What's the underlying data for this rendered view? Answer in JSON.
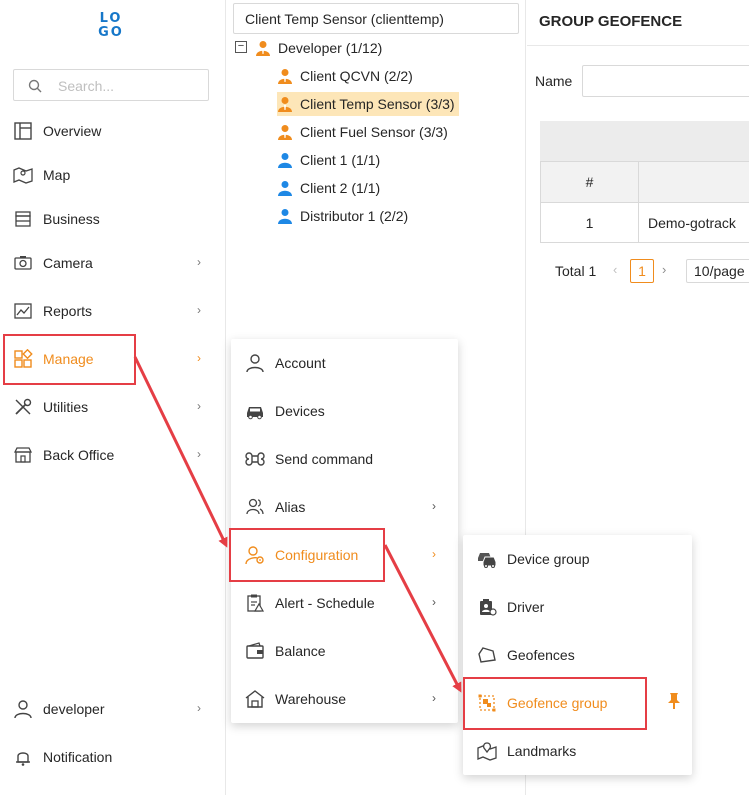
{
  "logo": {
    "line1": "LO",
    "line2": "GO"
  },
  "search": {
    "placeholder": "Search..."
  },
  "sidebar": {
    "items": [
      {
        "label": "Overview"
      },
      {
        "label": "Map"
      },
      {
        "label": "Business"
      },
      {
        "label": "Camera"
      },
      {
        "label": "Reports"
      },
      {
        "label": "Manage"
      },
      {
        "label": "Utilities"
      },
      {
        "label": "Back Office"
      }
    ],
    "bottom": [
      {
        "label": "developer"
      },
      {
        "label": "Notification"
      }
    ]
  },
  "tree": {
    "selected_value": "Client Temp Sensor (clienttemp)",
    "root": "Developer (1/12)",
    "children": [
      {
        "label": "Client QCVN (2/2)",
        "color": "#f08c1d"
      },
      {
        "label": "Client Temp Sensor (3/3)",
        "color": "#f08c1d"
      },
      {
        "label": "Client Fuel Sensor (3/3)",
        "color": "#f08c1d"
      },
      {
        "label": "Client 1 (1/1)",
        "color": "#1e88e5"
      },
      {
        "label": "Client 2 (1/1)",
        "color": "#1e88e5"
      },
      {
        "label": "Distributor 1 (2/2)",
        "color": "#1e88e5"
      }
    ]
  },
  "right_panel": {
    "title": "GROUP GEOFENCE",
    "name_label": "Name",
    "table": {
      "headers": [
        "#",
        ""
      ],
      "rows": [
        [
          "1",
          "Demo-gotrack"
        ]
      ]
    },
    "pager": {
      "total": "Total 1",
      "current_page": "1",
      "page_size": "10/page"
    }
  },
  "manage_menu": {
    "items": [
      {
        "label": "Account"
      },
      {
        "label": "Devices"
      },
      {
        "label": "Send command"
      },
      {
        "label": "Alias"
      },
      {
        "label": "Configuration"
      },
      {
        "label": "Alert - Schedule"
      },
      {
        "label": "Balance"
      },
      {
        "label": "Warehouse"
      }
    ]
  },
  "configuration_menu": {
    "items": [
      {
        "label": "Device group"
      },
      {
        "label": "Driver"
      },
      {
        "label": "Geofences"
      },
      {
        "label": "Geofence group"
      },
      {
        "label": "Landmarks"
      }
    ]
  },
  "colors": {
    "accent": "#f08c1d",
    "highlight": "#e53e45",
    "brand": "#1677c9"
  }
}
